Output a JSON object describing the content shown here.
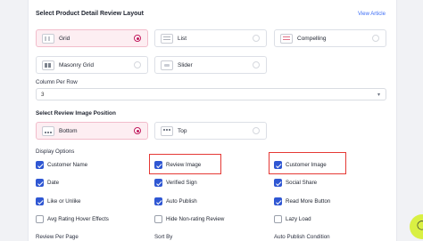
{
  "layout": {
    "title": "Select Product Detail Review Layout",
    "view_article": "View Article",
    "options": [
      {
        "label": "Grid",
        "icon": "grid-layout-icon",
        "selected": true
      },
      {
        "label": "List",
        "icon": "list-layout-icon",
        "selected": false
      },
      {
        "label": "Compelling",
        "icon": "compelling-layout-icon",
        "selected": false
      },
      {
        "label": "Masonry Grid",
        "icon": "masonry-layout-icon",
        "selected": false
      },
      {
        "label": "Slider",
        "icon": "slider-layout-icon",
        "selected": false
      }
    ]
  },
  "column": {
    "label": "Column Per Row",
    "value": "3"
  },
  "image_position": {
    "title": "Select Review Image Position",
    "options": [
      {
        "label": "Bottom",
        "icon": "image-bottom-icon",
        "selected": true
      },
      {
        "label": "Top",
        "icon": "image-top-icon",
        "selected": false
      }
    ]
  },
  "display": {
    "title": "Display Options",
    "options": [
      {
        "label": "Customer Name",
        "checked": true
      },
      {
        "label": "Review Image",
        "checked": true
      },
      {
        "label": "Customer Image",
        "checked": true
      },
      {
        "label": "Date",
        "checked": true
      },
      {
        "label": "Verified Sign",
        "checked": true
      },
      {
        "label": "Social Share",
        "checked": true
      },
      {
        "label": "Like or Unlike",
        "checked": true
      },
      {
        "label": "Auto Publish",
        "checked": true
      },
      {
        "label": "Read More Button",
        "checked": true
      },
      {
        "label": "Avg Rating Hover Effects",
        "checked": false
      },
      {
        "label": "Hide Non-rating Review",
        "checked": false
      },
      {
        "label": "Lazy Load",
        "checked": false
      }
    ]
  },
  "bottom_labels": {
    "review_per_page": "Review Per Page",
    "sort_by": "Sort By",
    "auto_publish_condition": "Auto Publish Condition"
  },
  "colors": {
    "accent": "#c2185b",
    "checkbox": "#2f57d3",
    "highlight": "#e53935",
    "fab": "#d9f043"
  }
}
